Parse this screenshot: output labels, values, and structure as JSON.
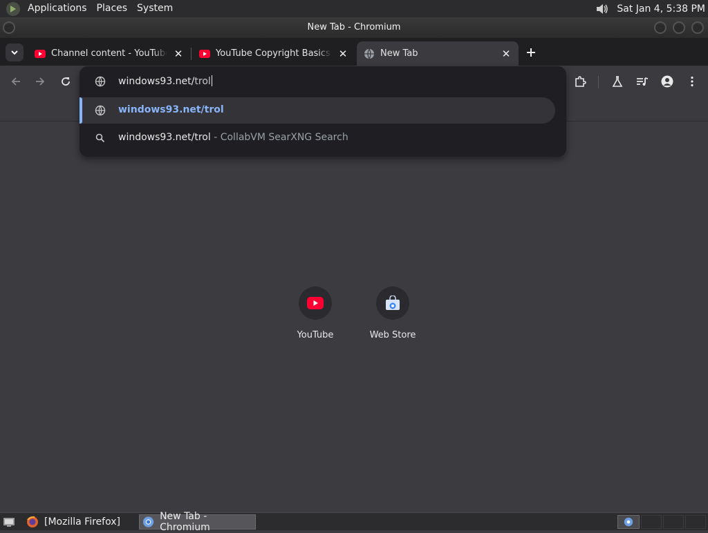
{
  "desktop": {
    "menu": [
      "Applications",
      "Places",
      "System"
    ],
    "clock": "Sat Jan  4,  5:38 PM"
  },
  "window": {
    "title": "New Tab - Chromium"
  },
  "tabs": [
    {
      "title": "Channel content - YouTube Studio",
      "favicon": "youtube-icon",
      "active": false
    },
    {
      "title": "YouTube Copyright Basics - YouTube",
      "favicon": "youtube-icon",
      "active": false
    },
    {
      "title": "New Tab",
      "favicon": "globe-icon",
      "active": true
    }
  ],
  "omnibox": {
    "typed": "windows93.net/",
    "completion": "trol",
    "suggestions": [
      {
        "text": "windows93.net/trol",
        "description": "",
        "icon": "globe-icon",
        "selected": true
      },
      {
        "text": "windows93.net/trol",
        "description": " - CollabVM SearXNG Search",
        "icon": "search-icon",
        "selected": false
      }
    ]
  },
  "shortcuts": [
    {
      "label": "YouTube",
      "icon": "youtube-icon"
    },
    {
      "label": "Web Store",
      "icon": "web-store-icon"
    }
  ],
  "taskbar": {
    "items": [
      {
        "label": "[Mozilla Firefox]",
        "icon": "firefox-icon",
        "active": false
      },
      {
        "label": "New Tab - Chromium",
        "icon": "chromium-icon",
        "active": true
      }
    ]
  },
  "colors": {
    "accent": "#8ab4f8",
    "youtube_red": "#ff0033",
    "background": "#3c3c40"
  }
}
